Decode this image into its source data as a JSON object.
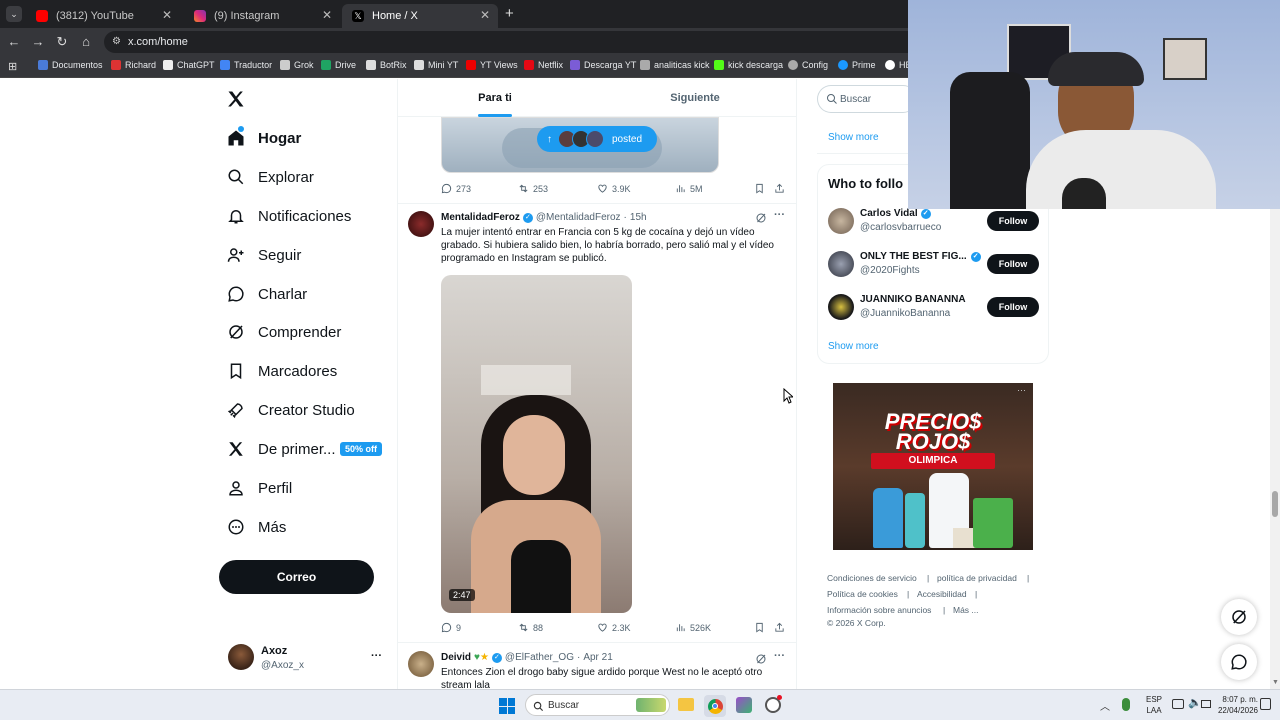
{
  "browser": {
    "tabs": [
      {
        "label": "(3812) YouTube",
        "color": "#ff0000"
      },
      {
        "label": "(9) Instagram",
        "color": "#e1306c"
      },
      {
        "label": "Home / X",
        "color": "#ffffff"
      }
    ],
    "url": "x.com/home",
    "bookmarks": [
      "Documentos",
      "Richard",
      "ChatGPT",
      "Traductor",
      "Grok",
      "Drive",
      "BotRix",
      "Mini YT",
      "YT Views",
      "Netflix",
      "Descarga YT",
      "analiticas kick",
      "kick descarga",
      "Config",
      "Prime",
      "HE"
    ]
  },
  "nav": {
    "items": [
      "Hogar",
      "Explorar",
      "Notificaciones",
      "Seguir",
      "Charlar",
      "Comprender",
      "Marcadores",
      "Creator Studio",
      "De primer...",
      "Perfil",
      "Más"
    ],
    "badge": "50% off",
    "post_button": "Correo",
    "user": {
      "name": "Axoz",
      "handle": "@Axoz_x",
      "more": "···"
    }
  },
  "feed": {
    "tabs": [
      "Para ti",
      "Siguiente"
    ],
    "posted_label": "posted",
    "top_actions": {
      "replies": "273",
      "reposts": "253",
      "likes": "3.9K",
      "views": "5M"
    },
    "post1": {
      "name": "MentalidadFeroz",
      "handle": "@MentalidadFeroz",
      "time": "15h",
      "text": "La mujer intentó entrar en Francia con 5 kg de cocaína y dejó un vídeo grabado. Si hubiera salido bien, lo habría borrado, pero salió mal y el vídeo programado en Instagram se publicó.",
      "duration": "2:47",
      "replies": "9",
      "reposts": "88",
      "likes": "2.3K",
      "views": "526K"
    },
    "post2": {
      "name": "Deivid",
      "handle": "@ElFather_OG",
      "time": "Apr 21",
      "text": "Entonces Zion el drogo baby sigue ardido porque West no le aceptó otro stream lala"
    }
  },
  "sidebar": {
    "search_placeholder": "Buscar",
    "show_more": "Show more",
    "who_to_follow": "Who to follo",
    "suggestions": [
      {
        "name": "Carlos Vidal",
        "handle": "@carlosvbarrueco"
      },
      {
        "name": "ONLY THE BEST FIG...",
        "handle": "@2020Fights"
      },
      {
        "name": "JUANNIKO BANANNA",
        "handle": "@JuannikoBananna"
      }
    ],
    "follow_label": "Follow",
    "ad": {
      "line1": "PRECIO$",
      "line2": "ROJO$",
      "brand": "OLIMPICA"
    },
    "footer": [
      "Condiciones de servicio",
      "|",
      "política de privacidad",
      "|",
      "Política de cookies",
      "|",
      "Accesibilidad",
      "|",
      "Información sobre anuncios",
      "|",
      "Más ...",
      "© 2026 X Corp."
    ]
  },
  "taskbar": {
    "search": "Buscar",
    "lang1": "ESP",
    "lang2": "LAA",
    "time": "8:07 p. m.",
    "date": "22/04/2026"
  },
  "colors": {
    "accent": "#1d9bf0",
    "dark": "#0f1419",
    "chrome": "#35363a"
  }
}
